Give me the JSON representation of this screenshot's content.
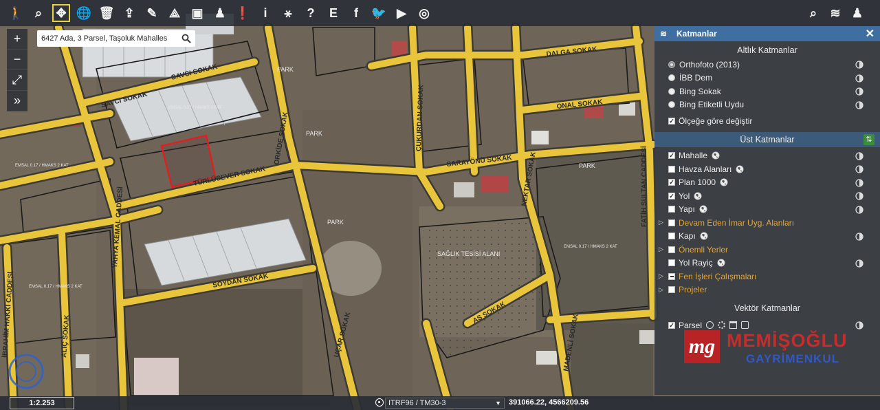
{
  "search": {
    "value": "6427 Ada, 3 Parsel, Taşoluk Mahalles"
  },
  "toolbar": {
    "left": [
      {
        "name": "pedestrian-icon",
        "glyph": "🚶",
        "active": false
      },
      {
        "name": "zoom-icon",
        "glyph": "⌕",
        "active": false
      },
      {
        "name": "pan-icon",
        "glyph": "✥",
        "active": true
      },
      {
        "name": "globe-icon",
        "glyph": "🌐",
        "active": false
      },
      {
        "name": "trash-icon",
        "glyph": "🗑",
        "active": false
      },
      {
        "name": "share-icon",
        "glyph": "⇪",
        "active": false
      },
      {
        "name": "pencil-icon",
        "glyph": "✎",
        "active": false
      },
      {
        "name": "measure-icon",
        "glyph": "⟁",
        "active": false
      },
      {
        "name": "image-icon",
        "glyph": "▣",
        "active": false
      },
      {
        "name": "street-view-icon",
        "glyph": "♟",
        "active": false
      },
      {
        "name": "comment-icon",
        "glyph": "❗",
        "active": false
      },
      {
        "name": "info-icon",
        "glyph": "i",
        "active": false
      },
      {
        "name": "network-icon",
        "glyph": "⚹",
        "active": false
      },
      {
        "name": "help-icon",
        "glyph": "?",
        "active": false
      },
      {
        "name": "e-icon",
        "glyph": "E",
        "active": false
      },
      {
        "name": "facebook-icon",
        "glyph": "f",
        "active": false
      },
      {
        "name": "twitter-icon",
        "glyph": "🐦",
        "active": false
      },
      {
        "name": "youtube-icon",
        "glyph": "▶",
        "active": false
      },
      {
        "name": "instagram-icon",
        "glyph": "◎",
        "active": false
      }
    ],
    "right": [
      {
        "name": "search-tool-icon",
        "glyph": "⌕"
      },
      {
        "name": "layers-tool-icon",
        "glyph": "≋"
      },
      {
        "name": "user-icon",
        "glyph": "♟"
      }
    ]
  },
  "zoom_panel": [
    {
      "name": "zoom-in-button",
      "glyph": "+"
    },
    {
      "name": "zoom-out-button",
      "glyph": "−"
    },
    {
      "name": "fullscreen-button",
      "glyph": "⤢"
    },
    {
      "name": "expand-button",
      "glyph": "»"
    }
  ],
  "layers": {
    "title": "Katmanlar",
    "close": "✕",
    "base_title": "Altlık Katmanlar",
    "base": [
      {
        "label": "Orthofoto (2013)",
        "selected": true
      },
      {
        "label": "İBB Dem",
        "selected": false
      },
      {
        "label": "Bing Sokak",
        "selected": false
      },
      {
        "label": "Bing Etiketli Uydu",
        "selected": false
      }
    ],
    "scale_label": "Ölçeğe göre değiştir",
    "upper_title": "Üst Katmanlar",
    "upper": [
      {
        "label": "Mahalle",
        "checked": true,
        "globe": true,
        "expander": false,
        "orange": false,
        "partial": false,
        "opacity": true
      },
      {
        "label": "Havza Alanları",
        "checked": false,
        "globe": true,
        "expander": false,
        "orange": false,
        "partial": false,
        "opacity": true
      },
      {
        "label": "Plan 1000",
        "checked": true,
        "globe": true,
        "expander": false,
        "orange": false,
        "partial": false,
        "opacity": true
      },
      {
        "label": "Yol",
        "checked": true,
        "globe": true,
        "expander": false,
        "orange": false,
        "partial": false,
        "opacity": true
      },
      {
        "label": "Yapı",
        "checked": false,
        "globe": true,
        "expander": false,
        "orange": false,
        "partial": false,
        "opacity": true
      },
      {
        "label": "Devam Eden İmar Uyg. Alanları",
        "checked": false,
        "globe": false,
        "expander": true,
        "orange": true,
        "partial": false,
        "opacity": false
      },
      {
        "label": "Kapı",
        "checked": false,
        "globe": true,
        "expander": false,
        "orange": false,
        "partial": false,
        "opacity": true
      },
      {
        "label": "Önemli Yerler",
        "checked": false,
        "globe": false,
        "expander": true,
        "orange": true,
        "partial": false,
        "opacity": false
      },
      {
        "label": "Yol Rayiç",
        "checked": false,
        "globe": true,
        "expander": false,
        "orange": false,
        "partial": false,
        "opacity": true
      },
      {
        "label": "Fen İşleri Çalışmaları",
        "checked": false,
        "globe": false,
        "expander": true,
        "orange": true,
        "partial": true,
        "opacity": false
      },
      {
        "label": "Projeler",
        "checked": false,
        "globe": false,
        "expander": true,
        "orange": true,
        "partial": false,
        "opacity": false
      }
    ],
    "vector_title": "Vektör Katmanlar",
    "vector": [
      {
        "label": "Parsel",
        "checked": true
      }
    ]
  },
  "map": {
    "street_labels": [
      "SAVCI SOKAK",
      "SAVCI SOKAK",
      "TÜRLÜSEVER SOKAK",
      "SOYDAN SOKAK",
      "YAHYA KEMAL CADDESİ",
      "İBRAHİM HAKKI CADDESİ",
      "ALIÇ SOKAK",
      "SARAYÖNÜ SOKAK",
      "DALGA SOKAK",
      "ONAL SOKAK",
      "FATİH SULTAN CADDESİ",
      "MADENLİ SOKAK",
      "AS SOKAK",
      "ORKİDE SOKAK",
      "ÇUKURDAN SOKAK",
      "NEKTAR SOKAK",
      "UÇAR SOKAK"
    ],
    "area_labels": [
      "PARK",
      "PARK",
      "PARK",
      "PARK",
      "SAĞLIK TESİSİ ALANI"
    ],
    "plan_note": "EMSAL 0.17 / HMAKS 2 KAT"
  },
  "watermark": {
    "mark": "mg",
    "name": "MEMİŞOĞLU",
    "sub": "GAYRİMENKUL"
  },
  "bottom": {
    "scale": "1:2.253",
    "crs": "ITRF96 / TM30-3",
    "coords": "391066.22, 4566209.56"
  }
}
